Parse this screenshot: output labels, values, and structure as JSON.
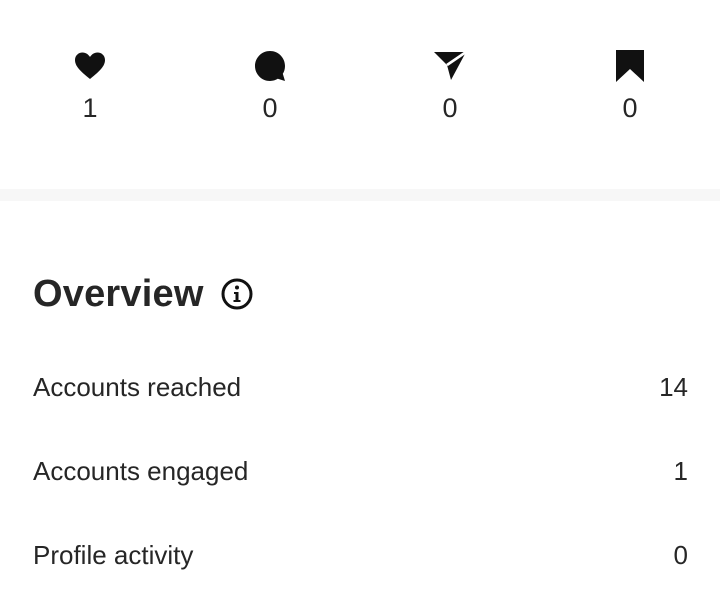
{
  "stats": {
    "likes": {
      "icon": "heart-icon",
      "count": "1"
    },
    "comments": {
      "icon": "comment-icon",
      "count": "0"
    },
    "shares": {
      "icon": "send-icon",
      "count": "0"
    },
    "saves": {
      "icon": "bookmark-icon",
      "count": "0"
    }
  },
  "overview": {
    "title": "Overview",
    "info_icon": "info-icon",
    "metrics": [
      {
        "label": "Accounts reached",
        "value": "14"
      },
      {
        "label": "Accounts engaged",
        "value": "1"
      },
      {
        "label": "Profile activity",
        "value": "0"
      }
    ]
  },
  "colors": {
    "text": "#262626",
    "divider": "#f7f7f7",
    "background": "#ffffff"
  }
}
